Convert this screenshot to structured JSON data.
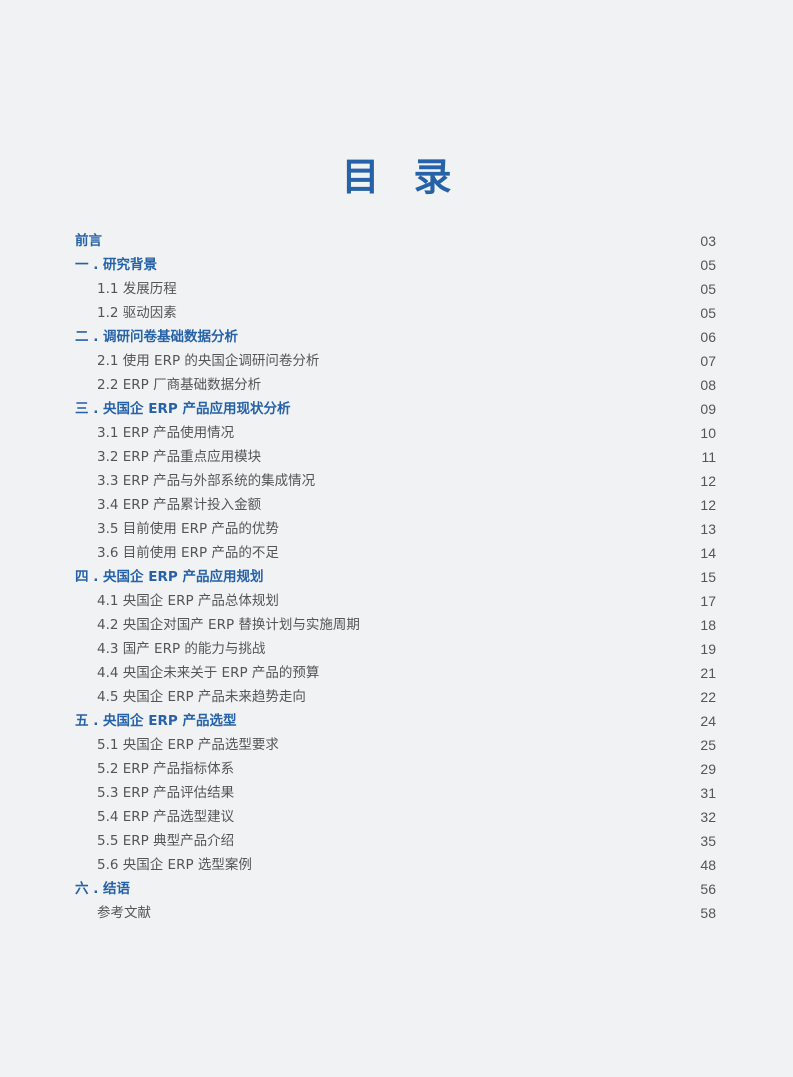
{
  "title": {
    "char1": "目",
    "char2": "录"
  },
  "toc": [
    {
      "level": "chapter",
      "label": "前言",
      "page": "03"
    },
    {
      "level": "chapter",
      "label": "一 . 研究背景",
      "page": "05"
    },
    {
      "level": "section",
      "label": "1.1 发展历程",
      "page": "05"
    },
    {
      "level": "section",
      "label": "1.2 驱动因素",
      "page": "05"
    },
    {
      "level": "chapter",
      "label": "二 . 调研问卷基础数据分析",
      "page": "06"
    },
    {
      "level": "section",
      "label": "2.1 使用 ERP 的央国企调研问卷分析",
      "page": "07"
    },
    {
      "level": "section",
      "label": "2.2 ERP 厂商基础数据分析",
      "page": "08"
    },
    {
      "level": "chapter",
      "label": "三 . 央国企 ERP 产品应用现状分析",
      "page": "09"
    },
    {
      "level": "section",
      "label": "3.1 ERP 产品使用情况",
      "page": "10"
    },
    {
      "level": "section",
      "label": "3.2 ERP 产品重点应用模块",
      "page": "11"
    },
    {
      "level": "section",
      "label": "3.3 ERP 产品与外部系统的集成情况",
      "page": "12"
    },
    {
      "level": "section",
      "label": "3.4 ERP 产品累计投入金额",
      "page": "12"
    },
    {
      "level": "section",
      "label": "3.5 目前使用 ERP 产品的优势",
      "page": "13"
    },
    {
      "level": "section",
      "label": "3.6 目前使用 ERP 产品的不足",
      "page": "14"
    },
    {
      "level": "chapter",
      "label": "四 . 央国企 ERP 产品应用规划",
      "page": "15"
    },
    {
      "level": "section",
      "label": "4.1 央国企 ERP 产品总体规划",
      "page": "17"
    },
    {
      "level": "section",
      "label": "4.2 央国企对国产 ERP 替换计划与实施周期",
      "page": "18"
    },
    {
      "level": "section",
      "label": "4.3 国产 ERP 的能力与挑战",
      "page": "19"
    },
    {
      "level": "section",
      "label": "4.4 央国企未来关于 ERP 产品的预算",
      "page": "21"
    },
    {
      "level": "section",
      "label": "4.5 央国企 ERP 产品未来趋势走向",
      "page": "22"
    },
    {
      "level": "chapter",
      "label": "五 . 央国企 ERP 产品选型",
      "page": "24"
    },
    {
      "level": "section",
      "label": "5.1 央国企 ERP 产品选型要求",
      "page": "25"
    },
    {
      "level": "section",
      "label": "5.2 ERP 产品指标体系",
      "page": "29"
    },
    {
      "level": "section",
      "label": "5.3 ERP 产品评估结果",
      "page": "31"
    },
    {
      "level": "section",
      "label": "5.4 ERP 产品选型建议",
      "page": "32"
    },
    {
      "level": "section",
      "label": "5.5 ERP 典型产品介绍",
      "page": "35"
    },
    {
      "level": "section",
      "label": "5.6 央国企 ERP 选型案例",
      "page": "48"
    },
    {
      "level": "chapter",
      "label": "六 . 结语",
      "page": "56"
    },
    {
      "level": "section",
      "label": "参考文献",
      "page": "58"
    }
  ],
  "colors": {
    "accent": "#2662a8",
    "text": "#555555",
    "background": "#f1f2f4"
  }
}
